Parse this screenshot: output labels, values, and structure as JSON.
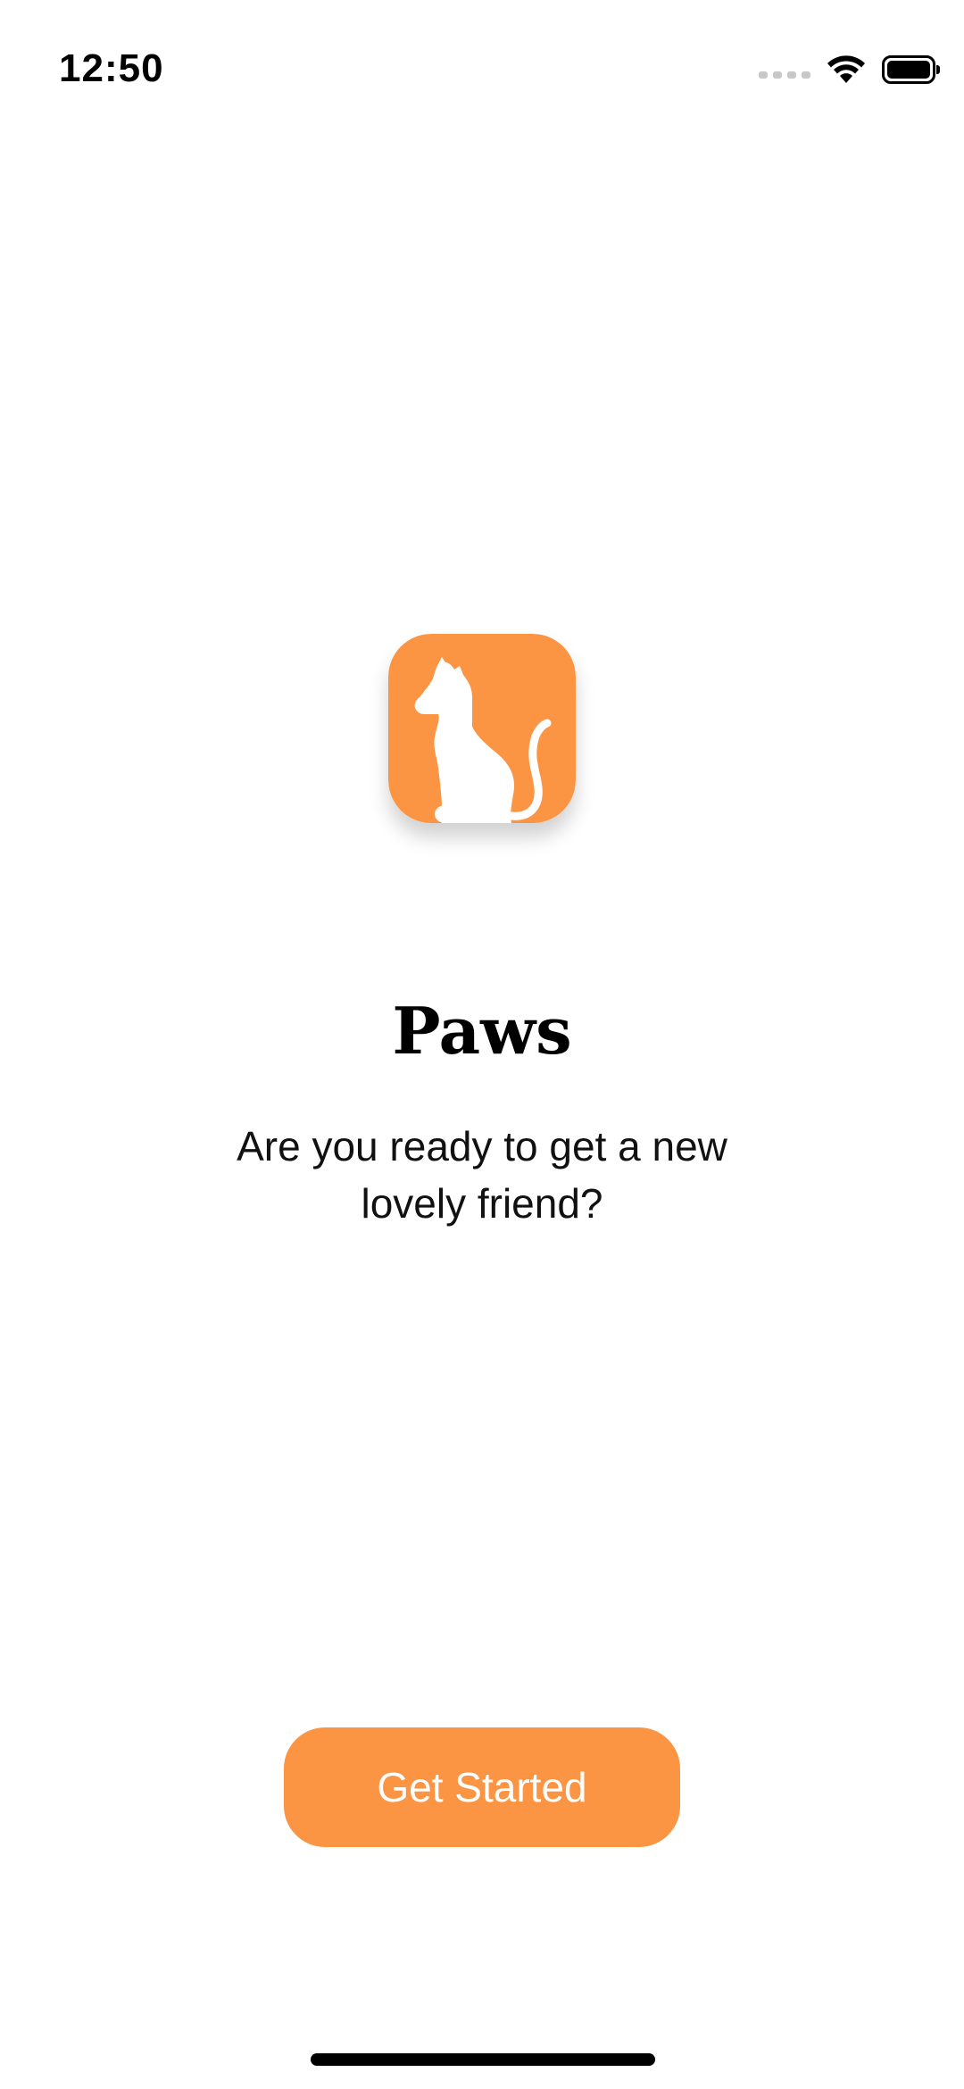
{
  "status_bar": {
    "time": "12:50",
    "icons": [
      "cellular-signal-icon",
      "wifi-icon",
      "battery-icon"
    ]
  },
  "app": {
    "logo_icon": "cat-silhouette-icon",
    "title": "Paws",
    "subtitle": "Are you ready to get a new lovely friend?"
  },
  "actions": {
    "get_started_label": "Get Started"
  },
  "colors": {
    "accent": "#fb9544",
    "background": "#ffffff",
    "text": "#000000"
  }
}
